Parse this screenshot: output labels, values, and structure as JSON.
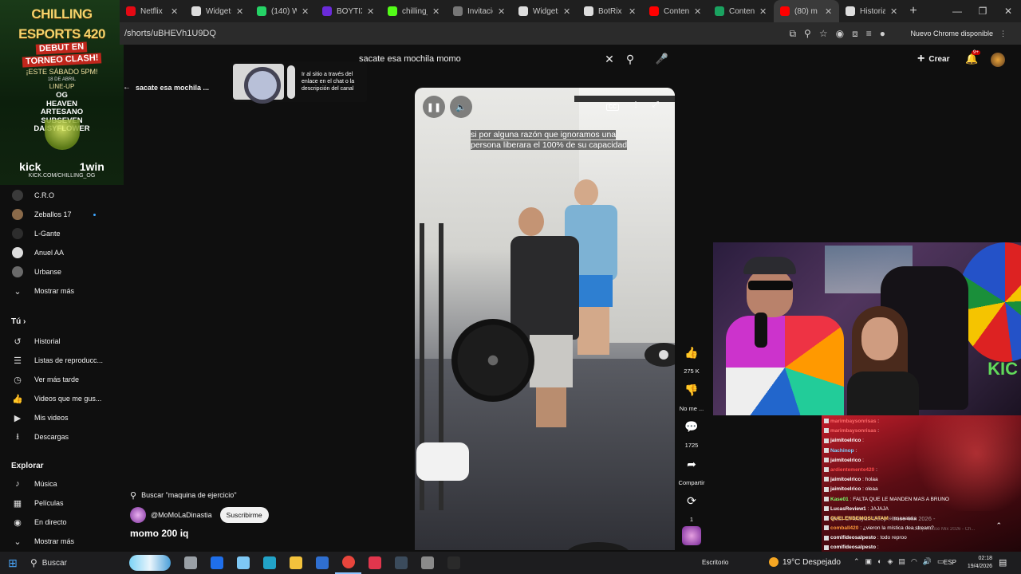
{
  "promo": {
    "line1": "CHILLING",
    "line2": "ESPORTS 420",
    "debut": "DEBUT EN",
    "torneo": "TORNEO CLASH!",
    "date": "¡ESTE SÁBADO 5PM!",
    "date_small": "18 DE ABRIL",
    "lineup": "LINE-UP",
    "names": [
      "OG",
      "HEAVEN",
      "ARTESANO",
      "SUBSEVEN",
      "DAISYFLOWER"
    ],
    "logo_left": "kick",
    "logo_right": "1win",
    "kick_url": "KICK.COM/CHILLING_OG"
  },
  "tabs": [
    {
      "label": "Netflix",
      "color": "#e50914",
      "active": false
    },
    {
      "label": "Widgets |",
      "color": "#dddddd",
      "active": false
    },
    {
      "label": "(140) Wh...",
      "color": "#25d366",
      "active": false
    },
    {
      "label": "BOYTIX -",
      "color": "#6a2bd9",
      "active": false
    },
    {
      "label": "chilling_o",
      "color": "#53fc18",
      "active": false
    },
    {
      "label": "Invitación",
      "color": "#777777",
      "active": false
    },
    {
      "label": "Widgets |",
      "color": "#dddddd",
      "active": false
    },
    {
      "label": "BotRix | S",
      "color": "#dddddd",
      "active": false
    },
    {
      "label": "Contenid",
      "color": "#ff0000",
      "active": false
    },
    {
      "label": "Contenid",
      "color": "#1aa260",
      "active": false
    },
    {
      "label": "(80) m",
      "color": "#ff0000",
      "active": true
    },
    {
      "label": "Historial",
      "color": "#dddddd",
      "active": false
    }
  ],
  "address": {
    "url": "/shorts/uBHEVh1U9DQ",
    "chrome_update": "Nuevo Chrome disponible"
  },
  "search": {
    "query": "sacate esa mochila momo"
  },
  "header": {
    "create": "Crear",
    "notif_badge": "9+"
  },
  "back": {
    "title": "sacate esa mochila ..."
  },
  "ad": {
    "text": "Ir al sitio a través del enlace en el chat o la descripción del canal"
  },
  "sidebar": {
    "subs": [
      {
        "label": "C.R.O",
        "color": "#3a3a3a",
        "dot": false
      },
      {
        "label": "Zeballos 17",
        "color": "#8a6a4a",
        "dot": true
      },
      {
        "label": "L-Gante",
        "color": "#2d2d2d",
        "dot": false
      },
      {
        "label": "Anuel AA",
        "color": "#dddddd",
        "dot": false
      },
      {
        "label": "Urbanse",
        "color": "#6a6a6a",
        "dot": false
      }
    ],
    "show_more": "Mostrar más",
    "you_heading": "Tú",
    "you_items": [
      {
        "label": "Historial",
        "icon": "history-icon",
        "glyph": "↺"
      },
      {
        "label": "Listas de reproducc...",
        "icon": "playlist-icon",
        "glyph": "☰"
      },
      {
        "label": "Ver más tarde",
        "icon": "clock-icon",
        "glyph": "◷"
      },
      {
        "label": "Videos que me gus...",
        "icon": "thumbs-up-icon",
        "glyph": "👍"
      },
      {
        "label": "Mis videos",
        "icon": "my-videos-icon",
        "glyph": "▶"
      },
      {
        "label": "Descargas",
        "icon": "download-icon",
        "glyph": "⭳"
      }
    ],
    "explore_heading": "Explorar",
    "explore_items": [
      {
        "label": "Música",
        "icon": "music-icon",
        "glyph": "♪"
      },
      {
        "label": "Películas",
        "icon": "movies-icon",
        "glyph": "▦"
      },
      {
        "label": "En directo",
        "icon": "live-icon",
        "glyph": "◉"
      },
      {
        "label": "Mostrar más",
        "icon": "chevron-down-icon",
        "glyph": "⌄"
      }
    ]
  },
  "video": {
    "caption_line1": "si por alguna razón que ignoramos una",
    "caption_line2": "persona liberara el 100% de su capacidad",
    "cc": "CC"
  },
  "actions": {
    "likes": "275 K",
    "dislike": "No me ...",
    "comments": "1725",
    "share": "Compartir",
    "remix": "1"
  },
  "meta": {
    "search_chip": "Buscar \"maquina de ejercicio\"",
    "channel": "@MoMoLaDinastia",
    "subscribe": "Suscribirme",
    "title": "momo 200 iq"
  },
  "chat": {
    "messages": [
      {
        "user": "marimbaysonrisas",
        "text": "",
        "color": "#ff6b6b"
      },
      {
        "user": "marimbaysonrisas",
        "text": "",
        "color": "#ff6b6b"
      },
      {
        "user": "jaimitoelrico",
        "text": "",
        "color": "#ffffff"
      },
      {
        "user": "Nachinop",
        "text": "",
        "color": "#7fd1ff"
      },
      {
        "user": "jaimitoelrico",
        "text": "",
        "color": "#ffffff"
      },
      {
        "user": "ardientemente420",
        "text": "",
        "color": "#ff4d4d"
      },
      {
        "user": "jaimitoelrico",
        "text": "holaa",
        "color": "#ffffff"
      },
      {
        "user": "jaimitoelrico",
        "text": "oleaa",
        "color": "#ffffff"
      },
      {
        "user": "Kase01",
        "text": "FALTA QUE LE MANDEN MAS A BRUNO",
        "color": "#7cff6b"
      },
      {
        "user": "LucasReview1",
        "text": "JAJAJA",
        "color": "#ffffff"
      },
      {
        "user": "QUELENDEMOSLATAM",
        "text": "insaaaaaa",
        "color": "#ffd166"
      },
      {
        "user": "comball420",
        "text": "¿vieron la mística dea stream?",
        "color": "#ff9a3c"
      },
      {
        "user": "comifideosalpesto",
        "text": "todo reproo",
        "color": "#ffffff"
      },
      {
        "user": "comifideosalpesto",
        "text": "",
        "color": "#ffffff"
      }
    ],
    "music_line": "Best Of Mayan Deep House Mix 2026 -",
    "music_line2": "Deep House Mix 2026 - Ch..."
  },
  "taskbar": {
    "search": "Buscar",
    "apps": [
      {
        "name": "task-view",
        "color": "#9aa0a6"
      },
      {
        "name": "store",
        "color": "#1f6feb"
      },
      {
        "name": "copilot",
        "color": "#7ec8f5"
      },
      {
        "name": "edge",
        "color": "#22a3c8"
      },
      {
        "name": "explorer",
        "color": "#f3c23c"
      },
      {
        "name": "outlook",
        "color": "#2f6fd0"
      },
      {
        "name": "chrome",
        "color": "#e8453c"
      },
      {
        "name": "obs-red",
        "color": "#e1364d"
      },
      {
        "name": "streamlabs",
        "color": "#3b4b5c"
      },
      {
        "name": "tool",
        "color": "#8a8a8a"
      },
      {
        "name": "obs",
        "color": "#2a2a2a"
      }
    ],
    "desktop": "Escritorio",
    "weather": "19°C  Despejado",
    "lang": "ESP",
    "time": "02:18",
    "date": "19/4/2026"
  }
}
